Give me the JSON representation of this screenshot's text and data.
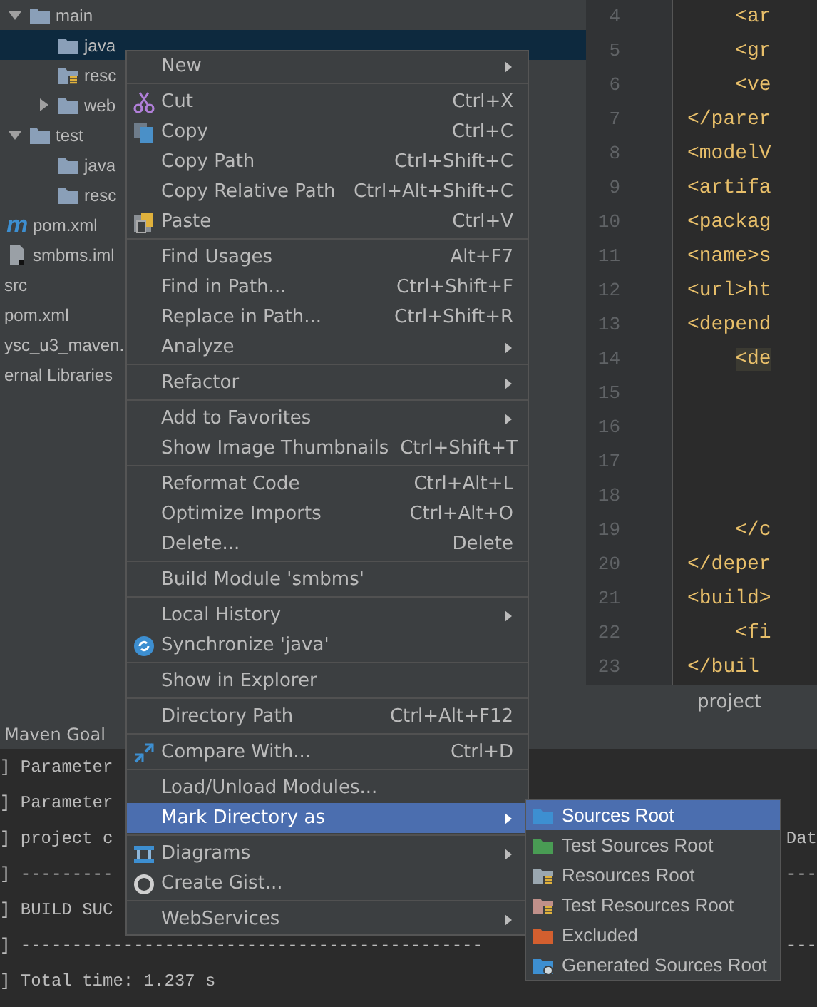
{
  "tree": {
    "items": [
      {
        "label": "main",
        "kind": "folder",
        "expanded": true,
        "selected": false,
        "children": [
          {
            "label": "java",
            "kind": "folder",
            "selected": true
          },
          {
            "label": "resc",
            "kind": "resources",
            "selected": false
          },
          {
            "label": "web",
            "kind": "folder",
            "expanded": false,
            "selected": false
          }
        ]
      },
      {
        "label": "test",
        "kind": "folder",
        "expanded": true,
        "selected": false,
        "children": [
          {
            "label": "java",
            "kind": "folder",
            "selected": false
          },
          {
            "label": "resc",
            "kind": "folder",
            "selected": false
          }
        ]
      },
      {
        "label": "pom.xml",
        "kind": "maven",
        "icon": "m",
        "selected": false
      },
      {
        "label": "smbms.iml",
        "kind": "iml",
        "selected": false
      },
      {
        "label": "src",
        "kind": "plain",
        "selected": false
      },
      {
        "label": "pom.xml",
        "kind": "plain",
        "selected": false
      },
      {
        "label": "ysc_u3_maven.",
        "kind": "plain",
        "selected": false
      },
      {
        "label": "ernal Libraries",
        "kind": "plain",
        "selected": false
      }
    ]
  },
  "editor": {
    "lines": [
      {
        "number": "4",
        "code": "    <ar",
        "highlighted": false
      },
      {
        "number": "5",
        "code": "    <gr",
        "highlighted": false
      },
      {
        "number": "6",
        "code": "    <ve",
        "highlighted": false
      },
      {
        "number": "7",
        "code": "</parer",
        "highlighted": false
      },
      {
        "number": "8",
        "code": "<modelV",
        "highlighted": false
      },
      {
        "number": "9",
        "code": "<artifa",
        "highlighted": false
      },
      {
        "number": "10",
        "code": "<packag",
        "highlighted": false
      },
      {
        "number": "11",
        "code": "<name>s",
        "highlighted": false
      },
      {
        "number": "12",
        "code": "<url>ht",
        "highlighted": false
      },
      {
        "number": "13",
        "code": "<depend",
        "highlighted": false
      },
      {
        "number": "14",
        "code": "    <de",
        "highlighted": true
      },
      {
        "number": "15"
      },
      {
        "number": "16"
      },
      {
        "number": "17"
      },
      {
        "number": "18"
      },
      {
        "number": "19",
        "code": "    </c",
        "highlighted": false
      },
      {
        "number": "20",
        "code": "</deper",
        "highlighted": false
      },
      {
        "number": "21",
        "code": "<build>",
        "highlighted": false
      },
      {
        "number": "22",
        "code": "    <fi",
        "highlighted": false
      },
      {
        "number": "23",
        "code": "</buil",
        "highlighted": false
      }
    ],
    "tab": "project"
  },
  "console": {
    "title": "Maven Goal",
    "lines": [
      {
        "text": "] Parameter"
      },
      {
        "text": "] Parameter"
      },
      {
        "text": "] project c",
        "tail": "Dat"
      },
      {
        "text": "] ---------",
        "tail": "---"
      },
      {
        "text": "] BUILD SUC"
      },
      {
        "text": "] ---------------------------------------------",
        "tail": "---"
      },
      {
        "text": "] Total time: 1.237 s"
      }
    ]
  },
  "menu": {
    "groups": [
      [
        {
          "label": "New",
          "submenu": true,
          "selected": false
        }
      ],
      [
        {
          "label": "Cut",
          "kind": "cut",
          "shortcut": "Ctrl+X",
          "submenu": false,
          "selected": false
        },
        {
          "label": "Copy",
          "kind": "copy",
          "shortcut": "Ctrl+C",
          "submenu": false,
          "selected": false
        },
        {
          "label": "Copy Path",
          "shortcut": "Ctrl+Shift+C",
          "submenu": false,
          "selected": false
        },
        {
          "label": "Copy Relative Path",
          "shortcut": "Ctrl+Alt+Shift+C",
          "submenu": false,
          "selected": false
        },
        {
          "label": "Paste",
          "kind": "paste",
          "shortcut": "Ctrl+V",
          "submenu": false,
          "selected": false
        }
      ],
      [
        {
          "label": "Find Usages",
          "shortcut": "Alt+F7",
          "submenu": false,
          "selected": false
        },
        {
          "label": "Find in Path...",
          "shortcut": "Ctrl+Shift+F",
          "submenu": false,
          "selected": false
        },
        {
          "label": "Replace in Path...",
          "shortcut": "Ctrl+Shift+R",
          "submenu": false,
          "selected": false
        },
        {
          "label": "Analyze",
          "submenu": true,
          "selected": false
        }
      ],
      [
        {
          "label": "Refactor",
          "submenu": true,
          "selected": false
        }
      ],
      [
        {
          "label": "Add to Favorites",
          "submenu": true,
          "selected": false
        },
        {
          "label": "Show Image Thumbnails",
          "shortcut": "Ctrl+Shift+T",
          "submenu": false,
          "selected": false
        }
      ],
      [
        {
          "label": "Reformat Code",
          "shortcut": "Ctrl+Alt+L",
          "submenu": false,
          "selected": false
        },
        {
          "label": "Optimize Imports",
          "shortcut": "Ctrl+Alt+O",
          "submenu": false,
          "selected": false
        },
        {
          "label": "Delete...",
          "shortcut": "Delete",
          "submenu": false,
          "selected": false
        }
      ],
      [
        {
          "label": "Build Module 'smbms'",
          "submenu": false,
          "selected": false
        }
      ],
      [
        {
          "label": "Local History",
          "submenu": true,
          "selected": false
        },
        {
          "label": "Synchronize 'java'",
          "kind": "sync",
          "submenu": false,
          "selected": false
        }
      ],
      [
        {
          "label": "Show in Explorer",
          "submenu": false,
          "selected": false
        }
      ],
      [
        {
          "label": "Directory Path",
          "shortcut": "Ctrl+Alt+F12",
          "submenu": false,
          "selected": false
        }
      ],
      [
        {
          "label": "Compare With...",
          "kind": "compare",
          "shortcut": "Ctrl+D",
          "submenu": false,
          "selected": false
        }
      ],
      [
        {
          "label": "Load/Unload Modules...",
          "submenu": false,
          "selected": false
        },
        {
          "label": "Mark Directory as",
          "submenu": true,
          "selected": true
        }
      ],
      [
        {
          "label": "Diagrams",
          "kind": "diagram",
          "submenu": true,
          "selected": false
        },
        {
          "label": "Create Gist...",
          "kind": "gist",
          "submenu": false,
          "selected": false
        }
      ],
      [
        {
          "label": "WebServices",
          "submenu": true,
          "selected": false
        }
      ]
    ]
  },
  "submenu": {
    "items": [
      {
        "label": "Sources Root",
        "kind": "folder",
        "color": "#3d8fd1",
        "selected": true
      },
      {
        "label": "Test Sources Root",
        "kind": "folder",
        "color": "#499c54",
        "selected": false
      },
      {
        "label": "Resources Root",
        "kind": "lines",
        "color": "#9aa7b0",
        "selected": false
      },
      {
        "label": "Test Resources Root",
        "kind": "lines",
        "color": "#c0908a",
        "selected": false
      },
      {
        "label": "Excluded",
        "kind": "folder",
        "color": "#d35f2f",
        "selected": false
      },
      {
        "label": "Generated Sources Root",
        "kind": "gear",
        "color": "#3d8fd1",
        "selected": false
      }
    ]
  }
}
